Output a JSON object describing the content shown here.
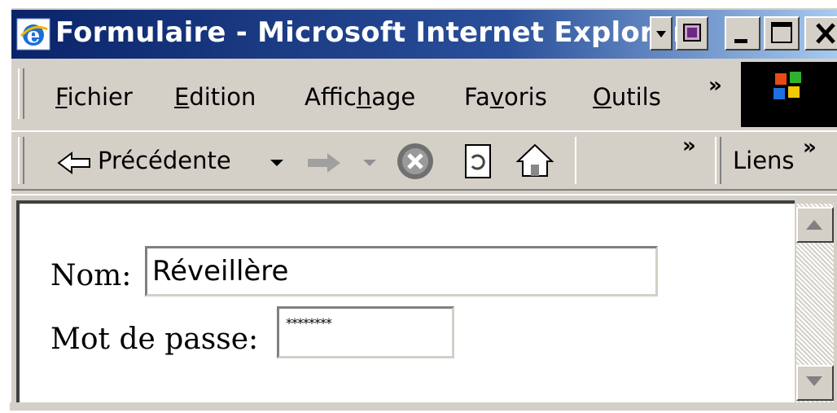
{
  "window": {
    "title": "Formulaire - Microsoft Internet Explorer"
  },
  "menu": {
    "items": [
      {
        "label": "Fichier",
        "accel": "F"
      },
      {
        "label": "Edition",
        "accel": "E"
      },
      {
        "label": "Affichage",
        "accel": "h"
      },
      {
        "label": "Favoris",
        "accel": "v"
      },
      {
        "label": "Outils",
        "accel": "O"
      }
    ],
    "overflow": "»"
  },
  "toolbar": {
    "back_label": "Précédente",
    "overflow": "»",
    "links_label": "Liens",
    "links_overflow": "»"
  },
  "form": {
    "name_label": "Nom:",
    "name_value": "Réveillère",
    "password_label": "Mot de passe:",
    "password_value": "********"
  },
  "colors": {
    "titlebar_start": "#0a246a",
    "titlebar_end": "#a6caf0",
    "chrome": "#d4d0c8"
  }
}
